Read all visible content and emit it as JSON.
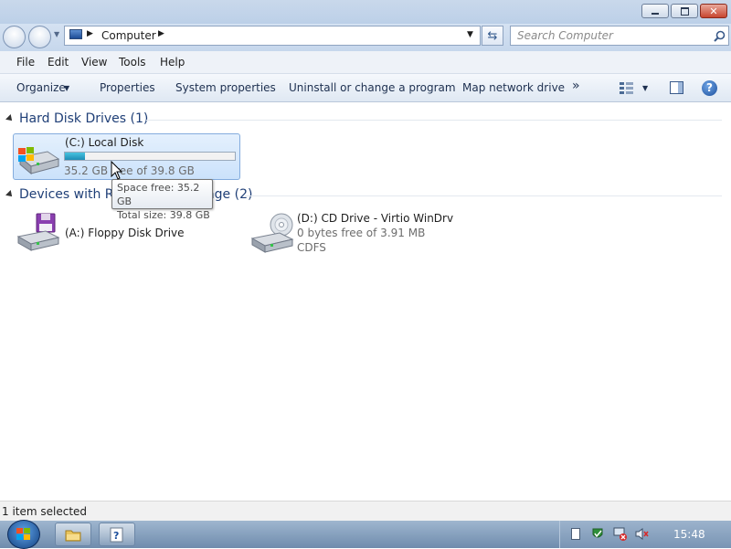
{
  "window": {
    "controls": {
      "minimize": "minimize",
      "maximize": "restore",
      "close": "close"
    }
  },
  "address": {
    "crumb": "Computer",
    "search_placeholder": "Search Computer"
  },
  "menu": {
    "items": [
      "File",
      "Edit",
      "View",
      "Tools",
      "Help"
    ]
  },
  "toolbar": {
    "organize": "Organize",
    "properties": "Properties",
    "system_properties": "System properties",
    "uninstall": "Uninstall or change a program",
    "map_drive": "Map network drive",
    "more": "»"
  },
  "groups": {
    "hard_disks": {
      "header": "Hard Disk Drives (1)"
    },
    "removable": {
      "header": "Devices with Removable Storage (2)"
    }
  },
  "drives": {
    "c": {
      "name": "(C:) Local Disk",
      "free_text": "35.2 GB free of 39.8 GB",
      "used_fraction": 0.12
    },
    "a": {
      "name": "(A:) Floppy Disk Drive"
    },
    "d": {
      "name": "(D:) CD Drive - Virtio WinDrv",
      "free_text": "0 bytes free of 3.91 MB",
      "fs": "CDFS"
    }
  },
  "tooltip": {
    "space_free": "Space free: 35.2 GB",
    "total_size": "Total size: 39.8 GB"
  },
  "status": {
    "text": "1 item selected"
  },
  "taskbar": {
    "clock": "15:48"
  },
  "colors": {
    "accent": "#1f3f77",
    "selection": "#cbe2fb",
    "capacity_bar": "#1d8cb6"
  }
}
